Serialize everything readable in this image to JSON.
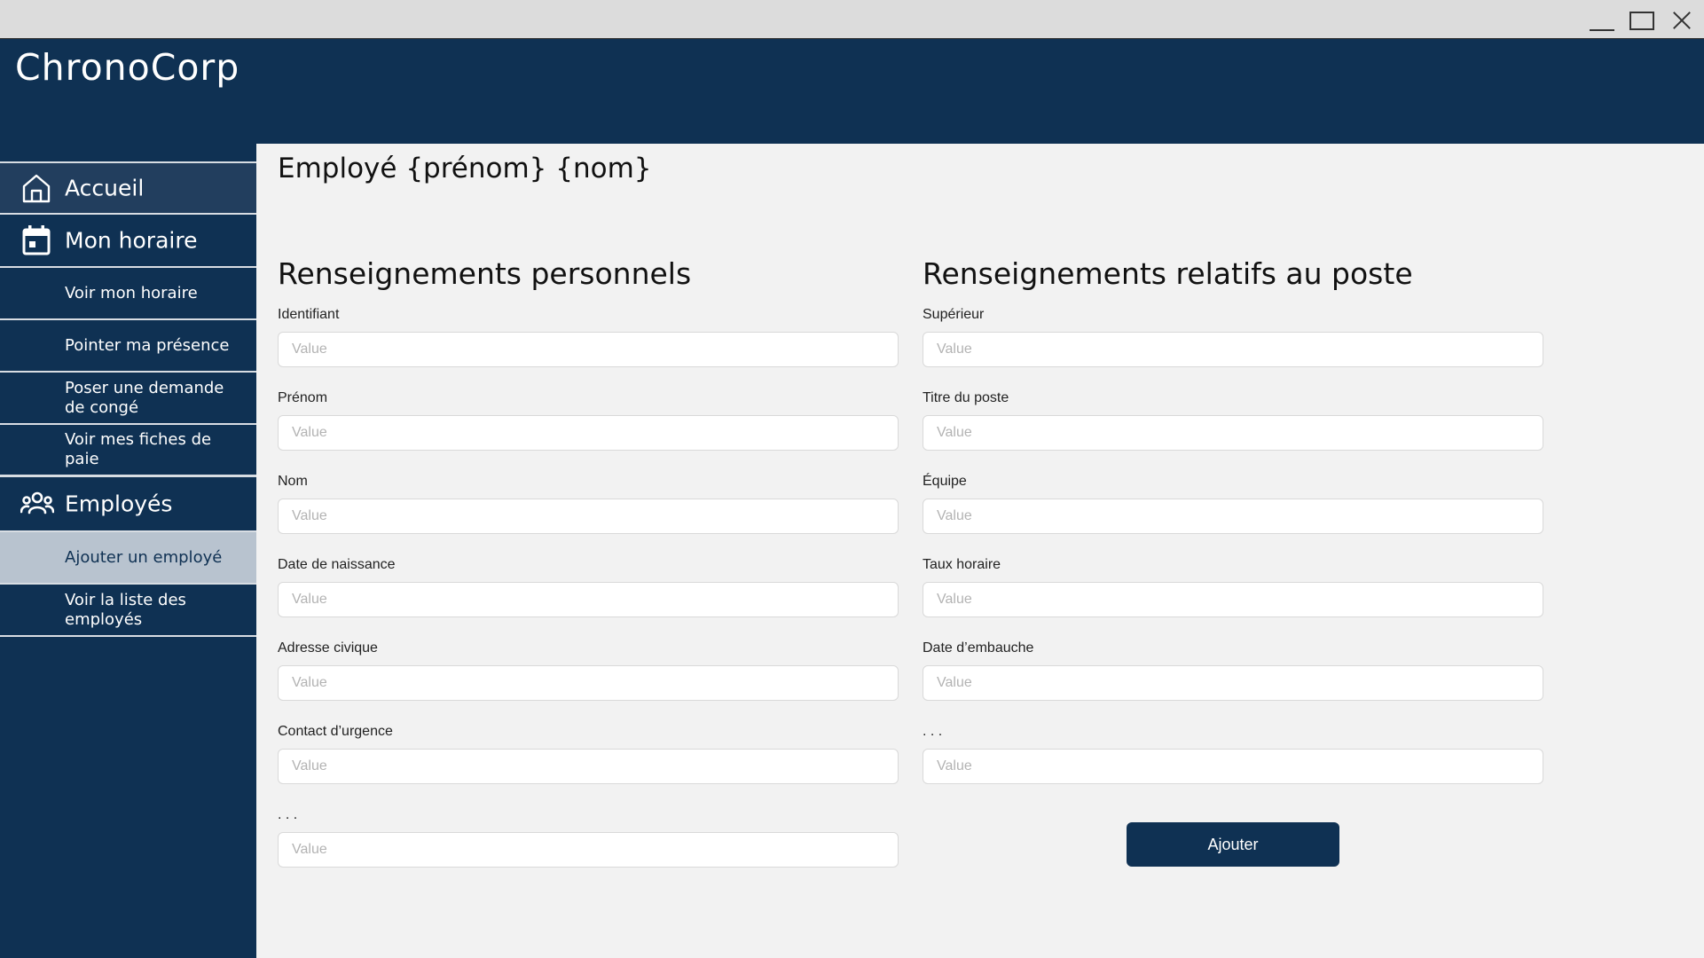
{
  "window": {
    "controls": {
      "minimize": "minimize-icon",
      "maximize": "maximize-icon",
      "close": "close-icon"
    }
  },
  "app": {
    "brand": "ChronoCorp"
  },
  "sidebar": {
    "accueil": {
      "label": "Accueil",
      "icon": "home-icon"
    },
    "horaire": {
      "label": "Mon horaire",
      "icon": "calendar-icon",
      "items": [
        "Voir mon horaire",
        "Pointer ma présence",
        "Poser une demande de congé",
        "Voir mes fiches de paie"
      ]
    },
    "employes": {
      "label": "Employés",
      "icon": "users-icon",
      "items": [
        "Ajouter un employé",
        "Voir la liste des employés"
      ],
      "active_item": "Ajouter un employé"
    }
  },
  "page": {
    "title": "Employé {prénom} {nom}"
  },
  "personal": {
    "title": "Renseignements personnels",
    "fields": [
      {
        "label": "Identifiant",
        "placeholder": "Value"
      },
      {
        "label": "Prénom",
        "placeholder": "Value"
      },
      {
        "label": "Nom",
        "placeholder": "Value"
      },
      {
        "label": "Date de naissance",
        "placeholder": "Value"
      },
      {
        "label": "Adresse civique",
        "placeholder": "Value"
      },
      {
        "label": "Contact d’urgence",
        "placeholder": "Value"
      },
      {
        "label": ". . .",
        "placeholder": "Value"
      }
    ]
  },
  "job": {
    "title": "Renseignements relatifs au poste",
    "fields": [
      {
        "label": "Supérieur",
        "placeholder": "Value"
      },
      {
        "label": "Titre du poste",
        "placeholder": "Value"
      },
      {
        "label": "Équipe",
        "placeholder": "Value"
      },
      {
        "label": "Taux horaire",
        "placeholder": "Value"
      },
      {
        "label": "Date d’embauche",
        "placeholder": "Value"
      },
      {
        "label": ". . .",
        "placeholder": "Value"
      }
    ]
  },
  "actions": {
    "submit_label": "Ajouter"
  },
  "colors": {
    "primary": "#0f3153",
    "active_nav": "#b8c3cf",
    "content_bg": "#f2f2f2"
  }
}
